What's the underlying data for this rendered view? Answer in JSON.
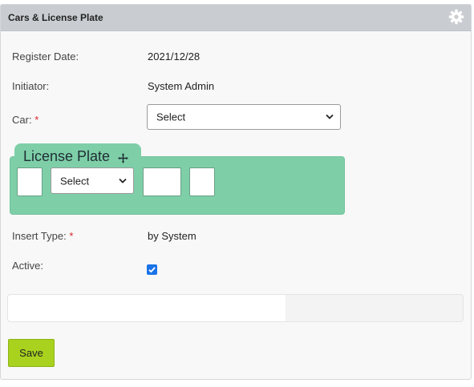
{
  "panel": {
    "title": "Cars & License Plate",
    "settings_icon": "gear-icon"
  },
  "form": {
    "register_date": {
      "label": "Register Date:",
      "value": "2021/12/28"
    },
    "initiator": {
      "label": "Initiator:",
      "value": "System Admin"
    },
    "car": {
      "label": "Car:",
      "required_mark": "*",
      "selected": "Select"
    },
    "license_plate": {
      "title": "License Plate",
      "move_icon": "move-icon",
      "letter_select": "Select",
      "color": "#7ecfa8"
    },
    "insert_type": {
      "label": "Insert Type:",
      "required_mark": "*",
      "value": "by System"
    },
    "active": {
      "label": "Active:",
      "checked": true
    },
    "progress": {
      "fraction": 0.61
    }
  },
  "actions": {
    "save_label": "Save"
  },
  "colors": {
    "accent_checkbox": "#1a73e8",
    "save_button": "#a8d21e",
    "required": "#d9232d"
  }
}
